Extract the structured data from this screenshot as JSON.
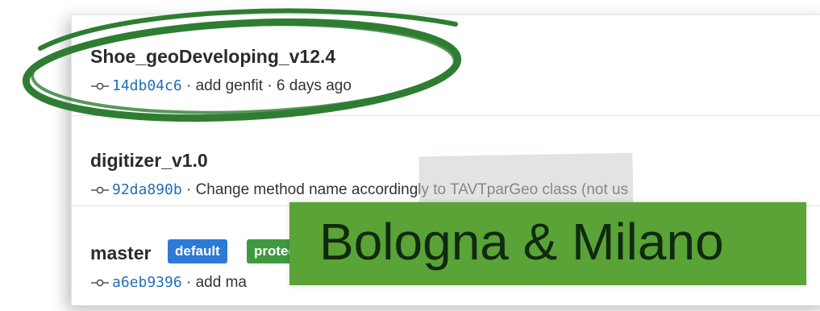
{
  "branches": [
    {
      "name": "Shoe_geoDeveloping_v12.4",
      "sha": "14db04c6",
      "message": " · add genfit · 6 days ago"
    },
    {
      "name": "digitizer_v1.0",
      "sha": "92da890b",
      "message": " · Change method name accordingly to TAVTparGeo class (not us"
    },
    {
      "name": "master",
      "sha": "a6eb9396",
      "message": " · add ma",
      "badges": [
        "default",
        "protected"
      ]
    }
  ],
  "overlay": {
    "label": "Bologna & Milano"
  },
  "colors": {
    "link": "#1f6fb8",
    "default_badge": "#2d7ad6",
    "protected_badge": "#3f9a3f",
    "label_green": "#5aa337",
    "marker_green": "#2f7d32"
  }
}
